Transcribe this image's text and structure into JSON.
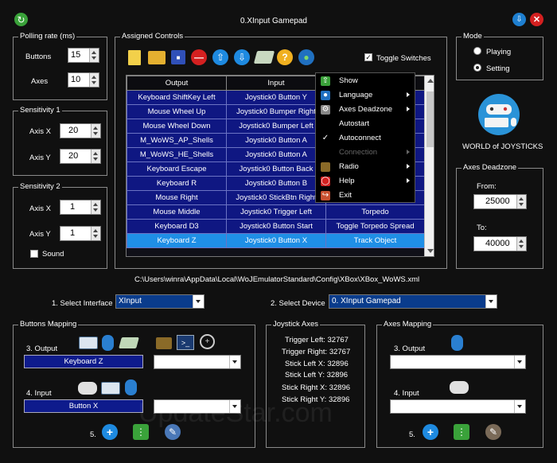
{
  "window": {
    "title": "0.XInput Gamepad"
  },
  "polling": {
    "title": "Polling rate (ms)",
    "buttons_label": "Buttons",
    "buttons_value": "15",
    "axes_label": "Axes",
    "axes_value": "10"
  },
  "sens1": {
    "title": "Sensitivity 1",
    "x_label": "Axis X",
    "x_value": "20",
    "y_label": "Axis Y",
    "y_value": "20"
  },
  "sens2": {
    "title": "Sensitivity 2",
    "x_label": "Axis X",
    "x_value": "1",
    "y_label": "Axis Y",
    "y_value": "1",
    "sound_label": "Sound"
  },
  "assigned": {
    "title": "Assigned Controls",
    "toggle_label": "Toggle Switches",
    "columns": [
      "Output",
      "Input",
      ""
    ],
    "rows": [
      [
        "Keyboard ShiftKey Left",
        "Joystick0 Button Y",
        ""
      ],
      [
        "Mouse Wheel Up",
        "Joystick0 Bumper Right",
        ""
      ],
      [
        "Mouse Wheel Down",
        "Joystick0 Bumper Left",
        ""
      ],
      [
        "M_WoWS_AP_Shells",
        "Joystick0 Button A",
        ""
      ],
      [
        "M_WoWS_HE_Shells",
        "Joystick0 Button A",
        ""
      ],
      [
        "Keyboard Escape",
        "Joystick0 Button Back",
        ""
      ],
      [
        "Keyboard R",
        "Joystick0 Button B",
        ""
      ],
      [
        "Mouse Right",
        "Joystick0 StickBtn Right",
        ""
      ],
      [
        "Mouse Middle",
        "Joystick0 Trigger Left",
        "Torpedo"
      ],
      [
        "Keyboard D3",
        "Joystick0 Button Start",
        "Toggle Torpedo Spread"
      ],
      [
        "Keyboard Z",
        "Joystick0 Button X",
        "Track Object"
      ]
    ],
    "selected_row": 10
  },
  "menu": {
    "items": [
      {
        "label": "Show",
        "icon": "arrow-up-green-icon",
        "sub": false,
        "disabled": false
      },
      {
        "label": "Language",
        "icon": "globe-icon",
        "sub": true,
        "disabled": false
      },
      {
        "label": "Axes Deadzone",
        "icon": "gear-icon",
        "sub": true,
        "disabled": false
      },
      {
        "label": "Autostart",
        "icon": "",
        "sub": false,
        "disabled": false
      },
      {
        "label": "Autoconnect",
        "icon": "check-icon",
        "sub": false,
        "disabled": false
      },
      {
        "label": "Connection",
        "icon": "",
        "sub": true,
        "disabled": true
      },
      {
        "label": "Radio",
        "icon": "radio-icon",
        "sub": true,
        "disabled": false
      },
      {
        "label": "Help",
        "icon": "lifebuoy-icon",
        "sub": true,
        "disabled": false
      },
      {
        "label": "Exit",
        "icon": "exit-icon",
        "sub": false,
        "disabled": false
      }
    ]
  },
  "mode": {
    "title": "Mode",
    "playing": "Playing",
    "setting": "Setting",
    "selected": "Setting"
  },
  "brand": {
    "name": "WORLD of JOYSTICKS"
  },
  "deadzone": {
    "title": "Axes Deadzone",
    "from_label": "From:",
    "from_value": "25000",
    "to_label": "To:",
    "to_value": "40000"
  },
  "path": "C:\\Users\\winra\\AppData\\Local\\WoJEmulatorStandard\\Config\\XBox\\XBox_WoWS.xml",
  "interface": {
    "label": "1. Select Interface",
    "value": "XInput"
  },
  "device": {
    "label": "2. Select Device",
    "value": "0. XInput Gamepad"
  },
  "buttons_mapping": {
    "title": "Buttons Mapping",
    "output_label": "3. Output",
    "output_value": "Keyboard Z",
    "input_label": "4. Input",
    "input_value": "Button X",
    "step5": "5."
  },
  "joystick_axes": {
    "title": "Joystick Axes",
    "lines": [
      "Trigger Left: 32767",
      "Trigger Right: 32767",
      "Stick Left X: 32896",
      "Stick Left Y: 32896",
      "Stick Right X: 32896",
      "Stick Right Y: 32896"
    ]
  },
  "axes_mapping": {
    "title": "Axes Mapping",
    "output_label": "3. Output",
    "input_label": "4. Input",
    "step5": "5."
  },
  "watermark": "UpdateStar.com"
}
